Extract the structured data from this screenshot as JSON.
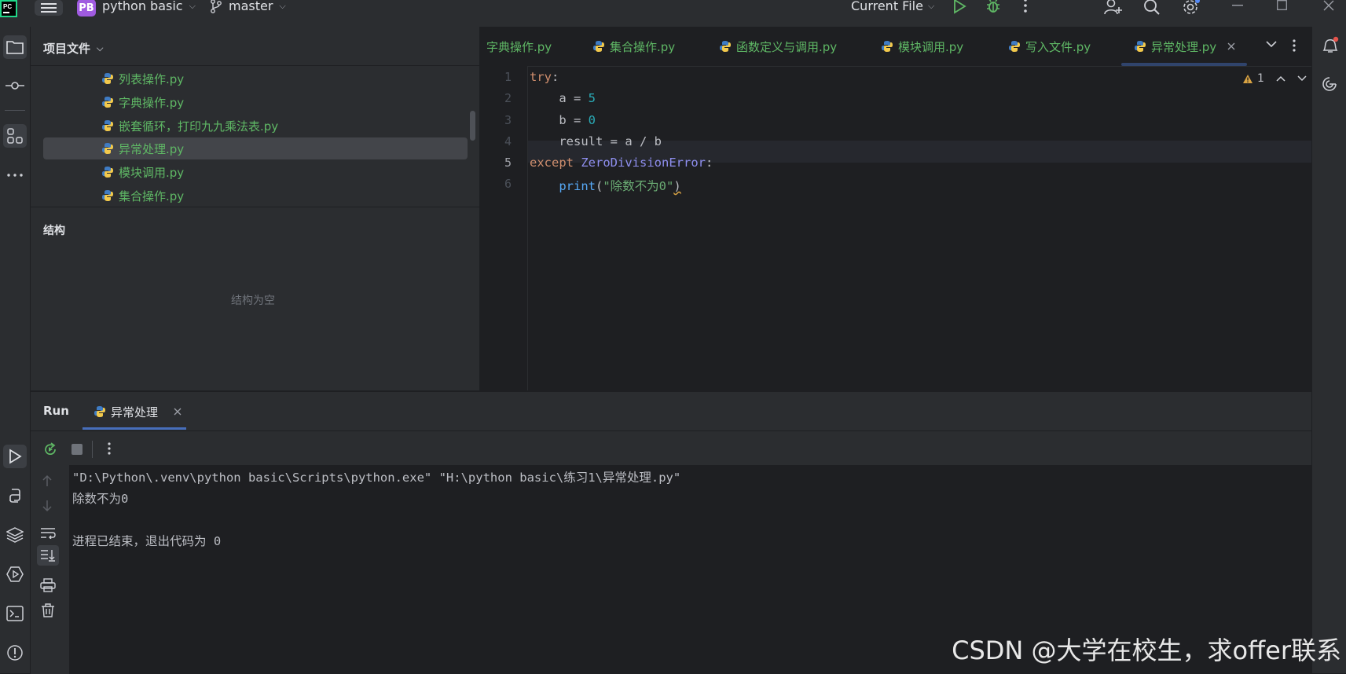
{
  "titlebar": {
    "project_badge": "PB",
    "project_name": "python basic",
    "branch": "master",
    "run_config": "Current File",
    "icons": [
      "pycharm-logo-icon",
      "hamburger-menu-icon",
      "branch-icon",
      "run-icon",
      "debug-icon",
      "more-icon",
      "add-user-icon",
      "search-icon",
      "settings-icon",
      "minimize-icon",
      "maximize-icon",
      "close-icon"
    ]
  },
  "project_panel": {
    "title": "项目文件",
    "files": [
      {
        "name": "列表操作.py"
      },
      {
        "name": "字典操作.py"
      },
      {
        "name": "嵌套循环，打印九九乘法表.py"
      },
      {
        "name": "异常处理.py",
        "selected": true
      },
      {
        "name": "模块调用.py"
      },
      {
        "name": "集合操作.py"
      }
    ],
    "structure_title": "结构",
    "structure_empty": "结构为空"
  },
  "editor": {
    "tabs": [
      {
        "label": "字典操作.py"
      },
      {
        "label": "集合操作.py"
      },
      {
        "label": "函数定义与调用.py"
      },
      {
        "label": "模块调用.py"
      },
      {
        "label": "写入文件.py"
      },
      {
        "label": "异常处理.py",
        "active": true
      }
    ],
    "warning_count": "1",
    "line_numbers": [
      "1",
      "2",
      "3",
      "4",
      "5",
      "6"
    ],
    "current_line": 5,
    "code": {
      "l1_kw": "try",
      "l1_rest": ":",
      "l2_a": "    a = ",
      "l2_num": "5",
      "l3_a": "    b = ",
      "l3_num": "0",
      "l4": "    result = a / b",
      "l5_kw": "except",
      "l5_cls": "ZeroDivisionError",
      "l5_rest": ":",
      "l6_indent": "    ",
      "l6_fn": "print",
      "l6_open": "(",
      "l6_str": "\"除数不为0\"",
      "l6_close": ")"
    }
  },
  "run_panel": {
    "title": "Run",
    "tab_label": "异常处理",
    "output": [
      "\"D:\\Python\\.venv\\python basic\\Scripts\\python.exe\" \"H:\\python basic\\练习1\\异常处理.py\"",
      "除数不为0",
      "",
      "进程已结束，退出代码为 0"
    ]
  },
  "watermark": "CSDN @大学在校生，求offer联系"
}
